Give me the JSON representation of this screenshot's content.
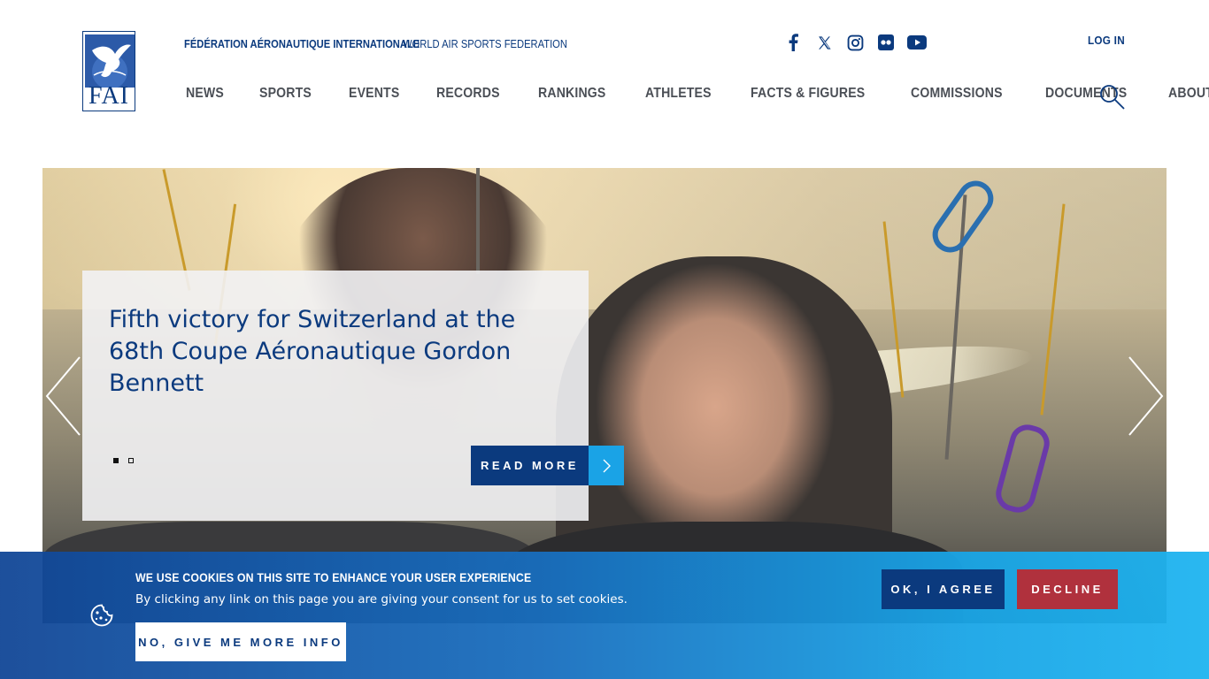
{
  "header": {
    "logo_text": "FAI",
    "org_name": "FÉDÉRATION AÉRONAUTIQUE INTERNATIONALE",
    "org_tagline": "WORLD AIR SPORTS FEDERATION",
    "login_label": "LOG IN",
    "social": [
      {
        "icon": "facebook-icon"
      },
      {
        "icon": "x-twitter-icon"
      },
      {
        "icon": "instagram-icon"
      },
      {
        "icon": "flickr-icon"
      },
      {
        "icon": "youtube-icon"
      }
    ]
  },
  "nav": {
    "items": [
      {
        "label": "News"
      },
      {
        "label": "Sports"
      },
      {
        "label": "Events"
      },
      {
        "label": "Records"
      },
      {
        "label": "Rankings"
      },
      {
        "label": "Athletes"
      },
      {
        "label": "Facts & Figures"
      },
      {
        "label": "Commissions"
      },
      {
        "label": "Documents"
      },
      {
        "label": "About"
      }
    ]
  },
  "hero": {
    "title": "Fifth victory for Switzerland at the 68th Coupe Aéronautique Gordon Bennett",
    "read_more_label": "Read more",
    "slide_count": 2,
    "active_slide": 1
  },
  "cookie": {
    "title": "We use cookies on this site to enhance your user experience",
    "description": "By clicking any link on this page you are giving your consent for us to set cookies.",
    "more_info_label": "No, give me more info",
    "agree_label": "OK, I agree",
    "decline_label": "Decline"
  },
  "colors": {
    "brand_blue": "#0b3a7e",
    "accent_cyan": "#1aa3e6",
    "decline_red": "#b0313d"
  }
}
